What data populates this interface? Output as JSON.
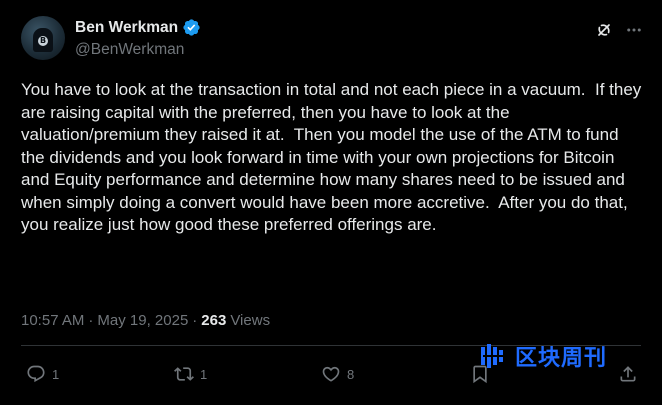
{
  "author": {
    "display_name": "Ben Werkman",
    "handle": "@BenWerkman",
    "verified": true
  },
  "tweet": {
    "text": "You have to look at the transaction in total and not each piece in a vacuum.  If they are raising capital with the preferred, then you have to look at the valuation/premium they raised it at.  Then you model the use of the ATM to fund the dividends and you look forward in time with your own projections for Bitcoin and Equity performance and determine how many shares need to be issued and when simply doing a convert would have been more accretive.  After you do that, you realize just how good these preferred offerings are."
  },
  "meta": {
    "time": "10:57 AM",
    "separator1": "·",
    "date": "May 19, 2025",
    "separator2": "·",
    "views_count": "263",
    "views_label": "Views"
  },
  "actions": {
    "replies": "1",
    "reposts": "1",
    "likes": "8"
  },
  "icons": {
    "header_right": [
      "grok-icon",
      "more-icon"
    ],
    "actions": [
      "reply-icon",
      "repost-icon",
      "like-icon",
      "bookmark-icon",
      "share-icon"
    ]
  },
  "colors": {
    "background": "#000000",
    "text_primary": "#e7e9ea",
    "text_secondary": "#71767b",
    "verified_blue": "#1d9bf0",
    "watermark_blue": "#1f6bff"
  },
  "watermark": {
    "text": "区块周刊"
  }
}
